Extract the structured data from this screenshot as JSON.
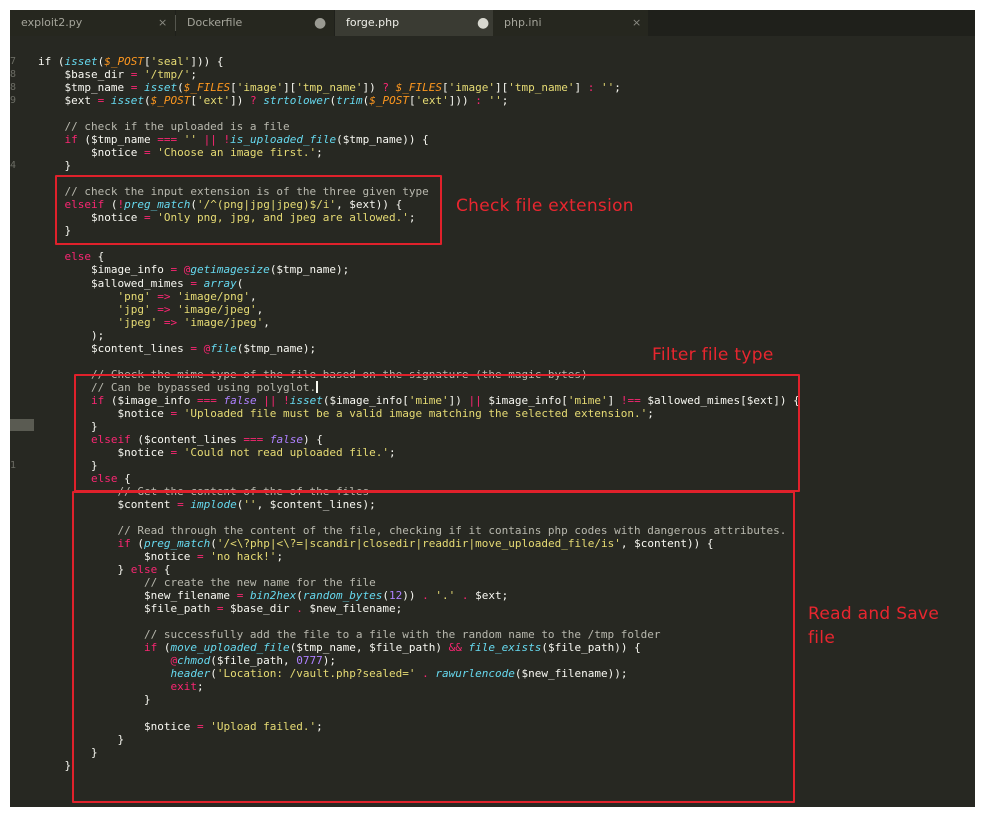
{
  "tabs": [
    {
      "label": "exploit2.py",
      "state": "close",
      "icon": "close-icon"
    },
    {
      "label": "Dockerfile",
      "state": "modified",
      "icon": "modified-dot-icon"
    },
    {
      "label": "forge.php",
      "state": "modified-active",
      "icon": "modified-dot-icon"
    },
    {
      "label": "php.ini",
      "state": "close",
      "icon": "close-icon"
    }
  ],
  "tab_icons": {
    "close": "×",
    "modified": "●"
  },
  "line_numbers": [
    "7",
    "8",
    "8",
    "9",
    "",
    "",
    "",
    "",
    "4",
    "",
    "",
    "",
    "",
    "",
    "",
    "",
    "",
    "",
    "",
    "",
    "",
    "",
    "",
    "",
    "",
    "",
    "",
    "",
    "",
    "",
    "",
    "1",
    "",
    "",
    "",
    "",
    "",
    "",
    "",
    "",
    "",
    "",
    "",
    "",
    "",
    "",
    "",
    "",
    "",
    "",
    "",
    "",
    "",
    "",
    "",
    "",
    "",
    "",
    "",
    "",
    "",
    ""
  ],
  "code_lines": [
    [
      [
        "if (",
        "t-plain"
      ],
      [
        "isset",
        "t-fn"
      ],
      [
        "(",
        "t-plain"
      ],
      [
        "$_POST",
        "t-sup"
      ],
      [
        "[",
        "t-plain"
      ],
      [
        "'seal'",
        "t-str"
      ],
      [
        "])) {",
        "t-plain"
      ]
    ],
    [
      [
        "    $base_dir ",
        "t-plain"
      ],
      [
        "=",
        "t-kw"
      ],
      [
        " ",
        "t-plain"
      ],
      [
        "'/tmp/'",
        "t-str"
      ],
      [
        ";",
        "t-plain"
      ]
    ],
    [
      [
        "    $tmp_name ",
        "t-plain"
      ],
      [
        "=",
        "t-kw"
      ],
      [
        " ",
        "t-plain"
      ],
      [
        "isset",
        "t-fn"
      ],
      [
        "(",
        "t-plain"
      ],
      [
        "$_FILES",
        "t-sup"
      ],
      [
        "[",
        "t-plain"
      ],
      [
        "'image'",
        "t-str"
      ],
      [
        "][",
        "t-plain"
      ],
      [
        "'tmp_name'",
        "t-str"
      ],
      [
        "]) ",
        "t-plain"
      ],
      [
        "?",
        "t-kw"
      ],
      [
        " ",
        "t-plain"
      ],
      [
        "$_FILES",
        "t-sup"
      ],
      [
        "[",
        "t-plain"
      ],
      [
        "'image'",
        "t-str"
      ],
      [
        "][",
        "t-plain"
      ],
      [
        "'tmp_name'",
        "t-str"
      ],
      [
        "] ",
        "t-plain"
      ],
      [
        ":",
        "t-kw"
      ],
      [
        " ",
        "t-plain"
      ],
      [
        "''",
        "t-str"
      ],
      [
        ";",
        "t-plain"
      ]
    ],
    [
      [
        "    $ext ",
        "t-plain"
      ],
      [
        "=",
        "t-kw"
      ],
      [
        " ",
        "t-plain"
      ],
      [
        "isset",
        "t-fn"
      ],
      [
        "(",
        "t-plain"
      ],
      [
        "$_POST",
        "t-sup"
      ],
      [
        "[",
        "t-plain"
      ],
      [
        "'ext'",
        "t-str"
      ],
      [
        "]) ",
        "t-plain"
      ],
      [
        "?",
        "t-kw"
      ],
      [
        " ",
        "t-plain"
      ],
      [
        "strtolower",
        "t-fn"
      ],
      [
        "(",
        "t-plain"
      ],
      [
        "trim",
        "t-fn"
      ],
      [
        "(",
        "t-plain"
      ],
      [
        "$_POST",
        "t-sup"
      ],
      [
        "[",
        "t-plain"
      ],
      [
        "'ext'",
        "t-str"
      ],
      [
        "])) ",
        "t-plain"
      ],
      [
        ":",
        "t-kw"
      ],
      [
        " ",
        "t-plain"
      ],
      [
        "''",
        "t-str"
      ],
      [
        ";",
        "t-plain"
      ]
    ],
    [],
    [
      [
        "    // check if the uploaded is a file",
        "t-cmt"
      ]
    ],
    [
      [
        "    ",
        "t-plain"
      ],
      [
        "if",
        "t-kw"
      ],
      [
        " ($tmp_name ",
        "t-plain"
      ],
      [
        "===",
        "t-kw"
      ],
      [
        " ",
        "t-plain"
      ],
      [
        "''",
        "t-str"
      ],
      [
        " ",
        "t-plain"
      ],
      [
        "||",
        "t-kw"
      ],
      [
        " ",
        "t-plain"
      ],
      [
        "!",
        "t-kw"
      ],
      [
        "is_uploaded_file",
        "t-fn"
      ],
      [
        "($tmp_name)) {",
        "t-plain"
      ]
    ],
    [
      [
        "        $notice ",
        "t-plain"
      ],
      [
        "=",
        "t-kw"
      ],
      [
        " ",
        "t-plain"
      ],
      [
        "'Choose an image first.'",
        "t-str"
      ],
      [
        ";",
        "t-plain"
      ]
    ],
    [
      [
        "    }",
        "t-plain"
      ]
    ],
    [],
    [
      [
        "    // check the input extension is of the three given type",
        "t-cmt"
      ]
    ],
    [
      [
        "    ",
        "t-plain"
      ],
      [
        "elseif",
        "t-kw"
      ],
      [
        " (",
        "t-plain"
      ],
      [
        "!",
        "t-kw"
      ],
      [
        "preg_match",
        "t-fn"
      ],
      [
        "(",
        "t-plain"
      ],
      [
        "'/^(png|jpg|jpeg)$/i'",
        "t-str"
      ],
      [
        ", $ext)) {",
        "t-plain"
      ]
    ],
    [
      [
        "        $notice ",
        "t-plain"
      ],
      [
        "=",
        "t-kw"
      ],
      [
        " ",
        "t-plain"
      ],
      [
        "'Only png, jpg, and jpeg are allowed.'",
        "t-str"
      ],
      [
        ";",
        "t-plain"
      ]
    ],
    [
      [
        "    }",
        "t-plain"
      ]
    ],
    [],
    [
      [
        "    ",
        "t-plain"
      ],
      [
        "else",
        "t-kw"
      ],
      [
        " {",
        "t-plain"
      ]
    ],
    [
      [
        "        $image_info ",
        "t-plain"
      ],
      [
        "=",
        "t-kw"
      ],
      [
        " ",
        "t-plain"
      ],
      [
        "@",
        "t-kw"
      ],
      [
        "getimagesize",
        "t-fn"
      ],
      [
        "($tmp_name);",
        "t-plain"
      ]
    ],
    [
      [
        "        $allowed_mimes ",
        "t-plain"
      ],
      [
        "=",
        "t-kw"
      ],
      [
        " ",
        "t-plain"
      ],
      [
        "array",
        "t-fn"
      ],
      [
        "(",
        "t-plain"
      ]
    ],
    [
      [
        "            ",
        "t-plain"
      ],
      [
        "'png'",
        "t-str"
      ],
      [
        " ",
        "t-plain"
      ],
      [
        "=>",
        "t-kw"
      ],
      [
        " ",
        "t-plain"
      ],
      [
        "'image/png'",
        "t-str"
      ],
      [
        ",",
        "t-plain"
      ]
    ],
    [
      [
        "            ",
        "t-plain"
      ],
      [
        "'jpg'",
        "t-str"
      ],
      [
        " ",
        "t-plain"
      ],
      [
        "=>",
        "t-kw"
      ],
      [
        " ",
        "t-plain"
      ],
      [
        "'image/jpeg'",
        "t-str"
      ],
      [
        ",",
        "t-plain"
      ]
    ],
    [
      [
        "            ",
        "t-plain"
      ],
      [
        "'jpeg'",
        "t-str"
      ],
      [
        " ",
        "t-plain"
      ],
      [
        "=>",
        "t-kw"
      ],
      [
        " ",
        "t-plain"
      ],
      [
        "'image/jpeg'",
        "t-str"
      ],
      [
        ",",
        "t-plain"
      ]
    ],
    [
      [
        "        );",
        "t-plain"
      ]
    ],
    [
      [
        "        $content_lines ",
        "t-plain"
      ],
      [
        "=",
        "t-kw"
      ],
      [
        " ",
        "t-plain"
      ],
      [
        "@",
        "t-kw"
      ],
      [
        "file",
        "t-fn"
      ],
      [
        "($tmp_name);",
        "t-plain"
      ]
    ],
    [],
    [
      [
        "        // Check the mime type of the file based on the signature (the magic bytes)",
        "t-cmt"
      ]
    ],
    [
      [
        "        // Can be bypassed using polyglot.",
        "t-cmt"
      ],
      [
        "|caret",
        "caret"
      ]
    ],
    [
      [
        "        ",
        "t-plain"
      ],
      [
        "if",
        "t-kw"
      ],
      [
        " ($image_info ",
        "t-plain"
      ],
      [
        "===",
        "t-kw"
      ],
      [
        " ",
        "t-plain"
      ],
      [
        "false",
        "t-ital"
      ],
      [
        " ",
        "t-plain"
      ],
      [
        "||",
        "t-kw"
      ],
      [
        " ",
        "t-plain"
      ],
      [
        "!",
        "t-kw"
      ],
      [
        "isset",
        "t-fn"
      ],
      [
        "($image_info[",
        "t-plain"
      ],
      [
        "'mime'",
        "t-str"
      ],
      [
        "]) ",
        "t-plain"
      ],
      [
        "||",
        "t-kw"
      ],
      [
        " $image_info[",
        "t-plain"
      ],
      [
        "'mime'",
        "t-str"
      ],
      [
        "] ",
        "t-plain"
      ],
      [
        "!==",
        "t-kw"
      ],
      [
        " $allowed_mimes[$ext]) {",
        "t-plain"
      ]
    ],
    [
      [
        "            $notice ",
        "t-plain"
      ],
      [
        "=",
        "t-kw"
      ],
      [
        " ",
        "t-plain"
      ],
      [
        "'Uploaded file must be a valid image matching the selected extension.'",
        "t-str"
      ],
      [
        ";",
        "t-plain"
      ]
    ],
    [
      [
        "        }",
        "t-plain"
      ]
    ],
    [
      [
        "        ",
        "t-plain"
      ],
      [
        "elseif",
        "t-kw"
      ],
      [
        " ($content_lines ",
        "t-plain"
      ],
      [
        "===",
        "t-kw"
      ],
      [
        " ",
        "t-plain"
      ],
      [
        "false",
        "t-ital"
      ],
      [
        ") {",
        "t-plain"
      ]
    ],
    [
      [
        "            $notice ",
        "t-plain"
      ],
      [
        "=",
        "t-kw"
      ],
      [
        " ",
        "t-plain"
      ],
      [
        "'Could not read uploaded file.'",
        "t-str"
      ],
      [
        ";",
        "t-plain"
      ]
    ],
    [
      [
        "        }",
        "t-plain"
      ]
    ],
    [
      [
        "        ",
        "t-plain"
      ],
      [
        "else",
        "t-kw"
      ],
      [
        " {",
        "t-plain"
      ]
    ],
    [
      [
        "            // Get the content of the of the files",
        "t-cmt"
      ]
    ],
    [
      [
        "            $content ",
        "t-plain"
      ],
      [
        "=",
        "t-kw"
      ],
      [
        " ",
        "t-plain"
      ],
      [
        "implode",
        "t-fn"
      ],
      [
        "(",
        "t-plain"
      ],
      [
        "''",
        "t-str"
      ],
      [
        ", $content_lines);",
        "t-plain"
      ]
    ],
    [],
    [
      [
        "            // Read through the content of the file, checking if it contains php codes with dangerous attributes.",
        "t-cmt"
      ]
    ],
    [
      [
        "            ",
        "t-plain"
      ],
      [
        "if",
        "t-kw"
      ],
      [
        " (",
        "t-plain"
      ],
      [
        "preg_match",
        "t-fn"
      ],
      [
        "(",
        "t-plain"
      ],
      [
        "'/<\\?php|<\\?=|scandir|closedir|readdir|move_uploaded_file/is'",
        "t-str"
      ],
      [
        ", $content)) {",
        "t-plain"
      ]
    ],
    [
      [
        "                $notice ",
        "t-plain"
      ],
      [
        "=",
        "t-kw"
      ],
      [
        " ",
        "t-plain"
      ],
      [
        "'no hack!'",
        "t-str"
      ],
      [
        ";",
        "t-plain"
      ]
    ],
    [
      [
        "            } ",
        "t-plain"
      ],
      [
        "else",
        "t-kw"
      ],
      [
        " {",
        "t-plain"
      ]
    ],
    [
      [
        "                // create the new name for the file",
        "t-cmt"
      ]
    ],
    [
      [
        "                $new_filename ",
        "t-plain"
      ],
      [
        "=",
        "t-kw"
      ],
      [
        " ",
        "t-plain"
      ],
      [
        "bin2hex",
        "t-fn"
      ],
      [
        "(",
        "t-plain"
      ],
      [
        "random_bytes",
        "t-fn"
      ],
      [
        "(",
        "t-plain"
      ],
      [
        "12",
        "t-num"
      ],
      [
        ")) ",
        "t-plain"
      ],
      [
        ".",
        "t-kw"
      ],
      [
        " ",
        "t-plain"
      ],
      [
        "'.'",
        "t-str"
      ],
      [
        " ",
        "t-plain"
      ],
      [
        ".",
        "t-kw"
      ],
      [
        " $ext;",
        "t-plain"
      ]
    ],
    [
      [
        "                $file_path ",
        "t-plain"
      ],
      [
        "=",
        "t-kw"
      ],
      [
        " $base_dir ",
        "t-plain"
      ],
      [
        ".",
        "t-kw"
      ],
      [
        " $new_filename;",
        "t-plain"
      ]
    ],
    [],
    [
      [
        "                // successfully add the file to a file with the random name to the /tmp folder",
        "t-cmt"
      ]
    ],
    [
      [
        "                ",
        "t-plain"
      ],
      [
        "if",
        "t-kw"
      ],
      [
        " (",
        "t-plain"
      ],
      [
        "move_uploaded_file",
        "t-fn"
      ],
      [
        "($tmp_name, $file_path) ",
        "t-plain"
      ],
      [
        "&&",
        "t-kw"
      ],
      [
        " ",
        "t-plain"
      ],
      [
        "file_exists",
        "t-fn"
      ],
      [
        "($file_path)) {",
        "t-plain"
      ]
    ],
    [
      [
        "                    ",
        "t-plain"
      ],
      [
        "@",
        "t-kw"
      ],
      [
        "chmod",
        "t-fn"
      ],
      [
        "($file_path, ",
        "t-plain"
      ],
      [
        "0777",
        "t-num"
      ],
      [
        ");",
        "t-plain"
      ]
    ],
    [
      [
        "                    ",
        "t-plain"
      ],
      [
        "header",
        "t-fn"
      ],
      [
        "(",
        "t-plain"
      ],
      [
        "'Location: /vault.php?sealed='",
        "t-str"
      ],
      [
        " ",
        "t-plain"
      ],
      [
        ".",
        "t-kw"
      ],
      [
        " ",
        "t-plain"
      ],
      [
        "rawurlencode",
        "t-fn"
      ],
      [
        "($new_filename));",
        "t-plain"
      ]
    ],
    [
      [
        "                    ",
        "t-plain"
      ],
      [
        "exit",
        "t-kw"
      ],
      [
        ";",
        "t-plain"
      ]
    ],
    [
      [
        "                }",
        "t-plain"
      ]
    ],
    [],
    [
      [
        "                $notice ",
        "t-plain"
      ],
      [
        "=",
        "t-kw"
      ],
      [
        " ",
        "t-plain"
      ],
      [
        "'Upload failed.'",
        "t-str"
      ],
      [
        ";",
        "t-plain"
      ]
    ],
    [
      [
        "            }",
        "t-plain"
      ]
    ],
    [
      [
        "        }",
        "t-plain"
      ]
    ],
    [
      [
        "    }",
        "t-plain"
      ]
    ]
  ],
  "annotations": [
    {
      "label": "Check file extension"
    },
    {
      "label": "Filter file type"
    },
    {
      "label": "Read and Save\nfile"
    }
  ],
  "colors": {
    "editor_bg": "#272822",
    "tab_bar_bg": "#1f201b",
    "active_tab_bg": "#3a3b33",
    "annotation": "#e0212b",
    "keyword": "#f92672",
    "function": "#66d9ef",
    "string": "#e6db74",
    "comment": "#b8b8ae",
    "number": "#ae81ff"
  }
}
